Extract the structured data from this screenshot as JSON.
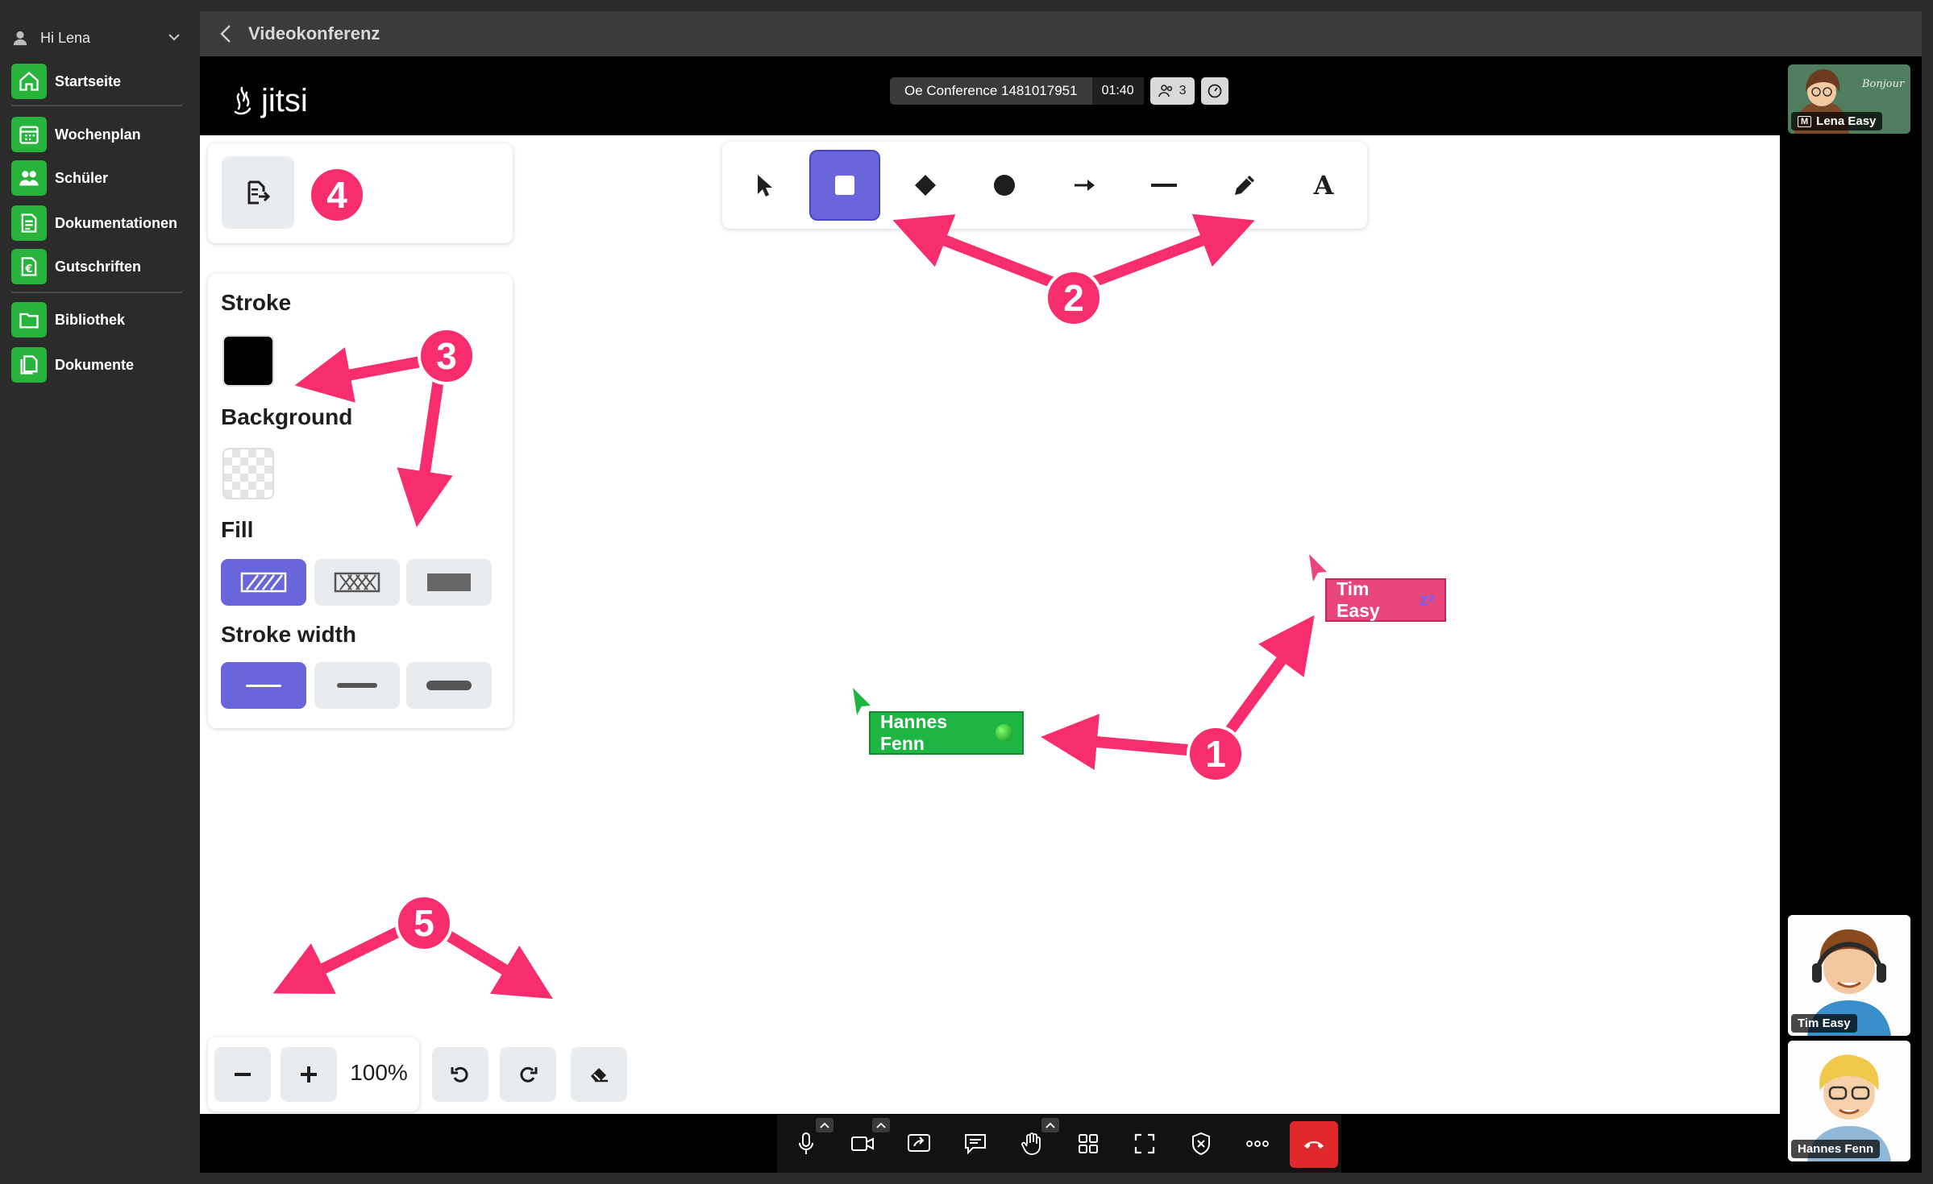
{
  "sidebar": {
    "greeting": "Hi Lena",
    "items": [
      {
        "label": "Startseite",
        "icon": "home-icon"
      },
      {
        "label": "Wochenplan",
        "icon": "calendar-icon"
      },
      {
        "label": "Schüler",
        "icon": "students-icon"
      },
      {
        "label": "Dokumentationen",
        "icon": "documentation-icon"
      },
      {
        "label": "Gutschriften",
        "icon": "credit-icon"
      },
      {
        "label": "Bibliothek",
        "icon": "library-icon"
      },
      {
        "label": "Dokumente",
        "icon": "documents-icon"
      }
    ]
  },
  "header": {
    "title": "Videokonferenz"
  },
  "meeting": {
    "logo": "jitsi",
    "name": "Oe Conference 1481017951",
    "time": "01:40",
    "participants": "3"
  },
  "whiteboard": {
    "tools": [
      "select-tool-icon",
      "rectangle-tool-icon",
      "diamond-tool-icon",
      "ellipse-tool-icon",
      "arrow-tool-icon",
      "line-tool-icon",
      "pencil-tool-icon",
      "text-tool-icon"
    ],
    "text_tool_label": "A",
    "properties": {
      "stroke_label": "Stroke",
      "background_label": "Background",
      "fill_label": "Fill",
      "stroke_width_label": "Stroke width",
      "stroke_color": "#000000"
    },
    "zoom": "100%",
    "cursors": {
      "hannes": "Hannes Fenn",
      "tim": "Tim Easy",
      "tim_status": "zᶻ"
    }
  },
  "annotations": {
    "b1": "1",
    "b2": "2",
    "b3": "3",
    "b4": "4",
    "b5": "5"
  },
  "filmstrip": {
    "local": "Lena Easy",
    "local_badge": "M",
    "remote1": "Tim Easy",
    "remote2": "Hannes Fenn"
  },
  "colors": {
    "accent": "#6965db",
    "annotation": "#f72d6e",
    "nav_green": "#28b43c",
    "hangup": "#e1292d"
  }
}
